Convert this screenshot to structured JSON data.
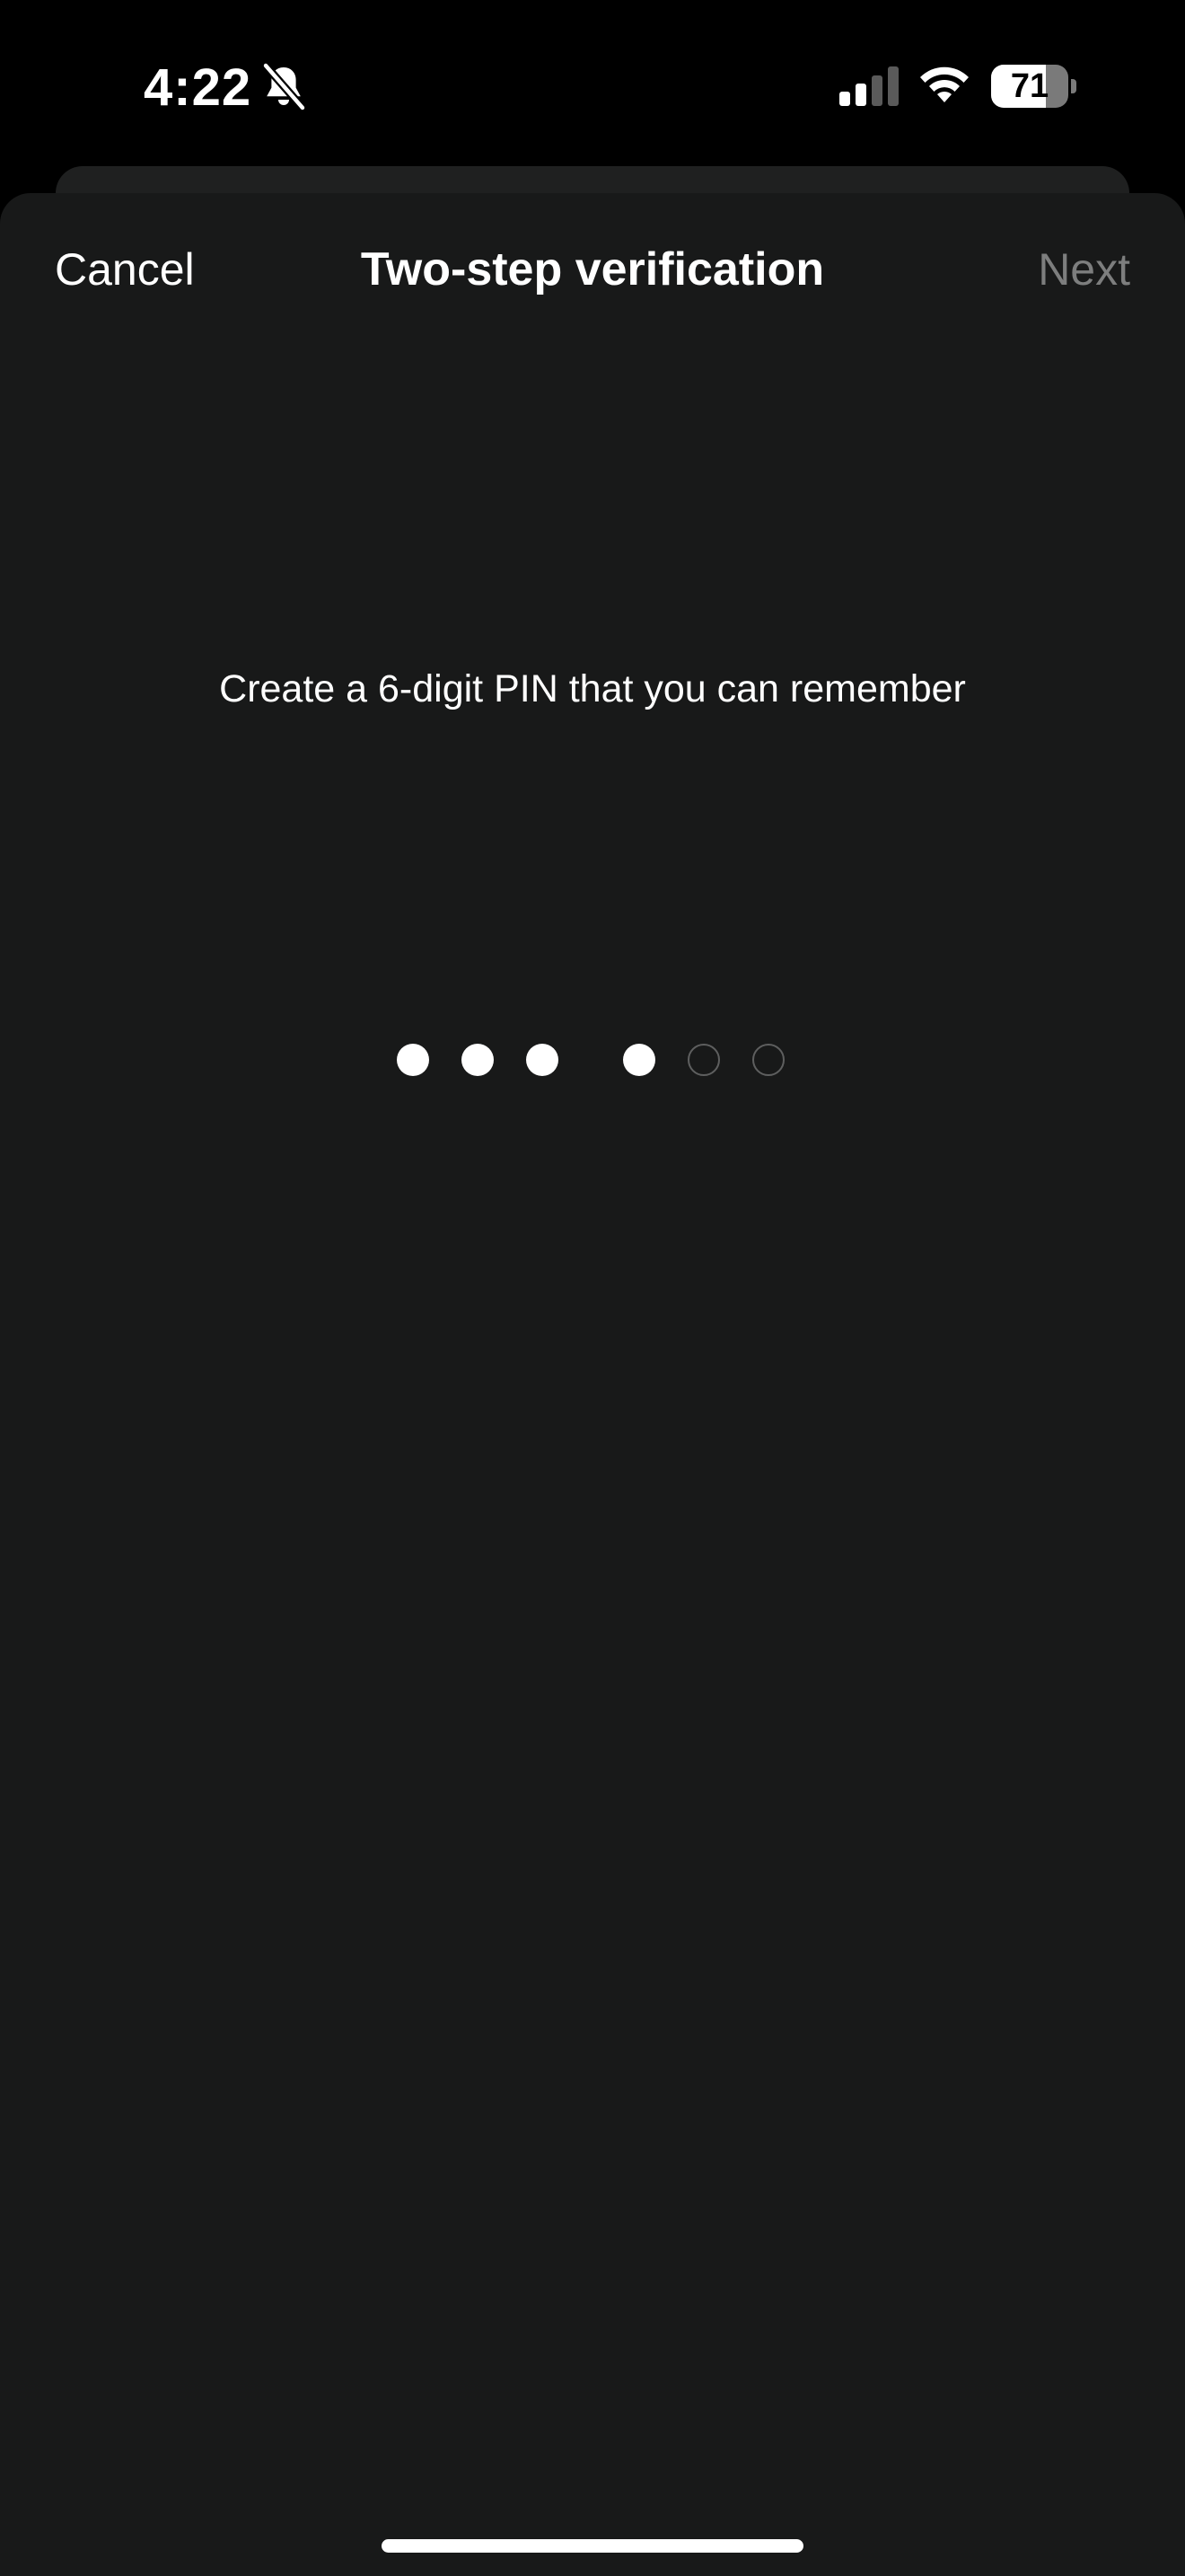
{
  "status_bar": {
    "time": "4:22",
    "battery_level": "71",
    "battery_fraction": 0.71,
    "icons": [
      "bell-slash-icon",
      "cellular-signal-icon",
      "wifi-icon",
      "battery-icon"
    ]
  },
  "nav": {
    "cancel_label": "Cancel",
    "title": "Two-step verification",
    "next_label": "Next"
  },
  "content": {
    "prompt": "Create a 6-digit PIN that you can remember",
    "pin": {
      "length": 6,
      "entered": 4
    }
  },
  "colors": {
    "background": "#000000",
    "sheet": "#181919",
    "back_sheet": "#1f2020",
    "text": "#ffffff",
    "disabled_text": "#7d7e7e",
    "empty_dot_border": "#5e5f5f"
  }
}
